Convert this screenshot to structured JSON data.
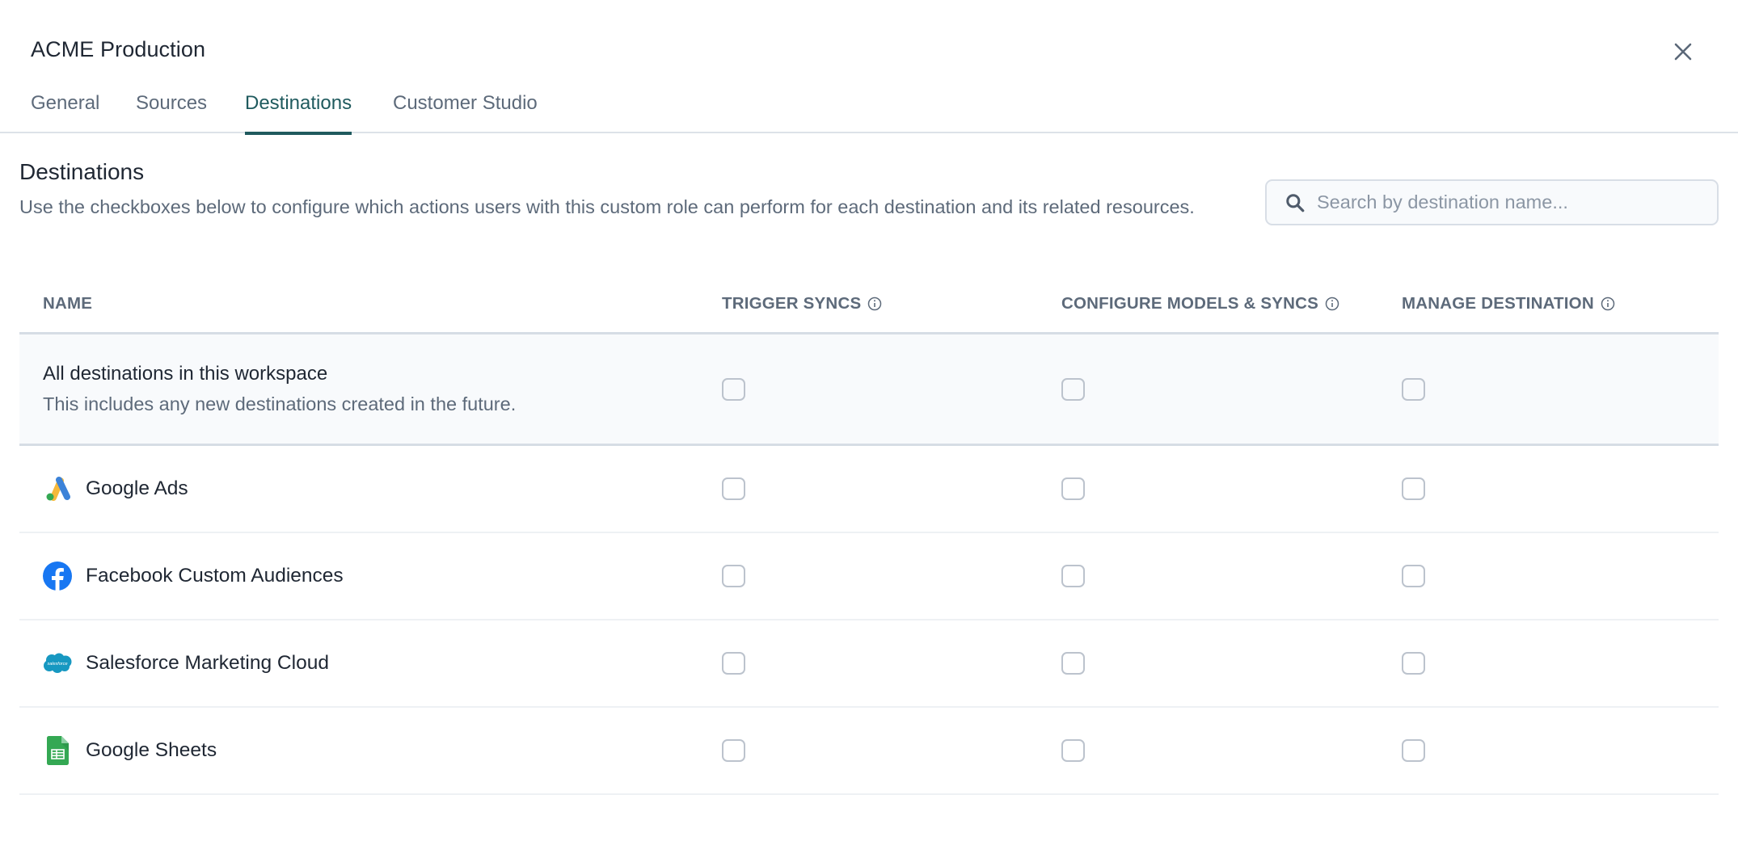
{
  "modal": {
    "title": "ACME Production",
    "close_icon": "close-icon"
  },
  "tabs": [
    {
      "label": "General",
      "active": false
    },
    {
      "label": "Sources",
      "active": false
    },
    {
      "label": "Destinations",
      "active": true
    },
    {
      "label": "Customer Studio",
      "active": false
    }
  ],
  "section": {
    "title": "Destinations",
    "description": "Use the checkboxes below to configure which actions users with this custom role can perform for each destination and its related resources."
  },
  "search": {
    "placeholder": "Search by destination name...",
    "value": "",
    "icon": "search-icon"
  },
  "table": {
    "columns": [
      {
        "label": "NAME",
        "info": false
      },
      {
        "label": "TRIGGER SYNCS",
        "info": true
      },
      {
        "label": "CONFIGURE MODELS & SYNCS",
        "info": true
      },
      {
        "label": "MANAGE DESTINATION",
        "info": true
      }
    ],
    "all_row": {
      "title": "All destinations in this workspace",
      "subtitle": "This includes any new destinations created in the future.",
      "trigger_syncs": false,
      "configure_models_syncs": false,
      "manage_destination": false
    },
    "rows": [
      {
        "name": "Google Ads",
        "icon": "google-ads-icon",
        "trigger_syncs": false,
        "configure_models_syncs": false,
        "manage_destination": false
      },
      {
        "name": "Facebook Custom Audiences",
        "icon": "facebook-icon",
        "trigger_syncs": false,
        "configure_models_syncs": false,
        "manage_destination": false
      },
      {
        "name": "Salesforce Marketing Cloud",
        "icon": "salesforce-icon",
        "trigger_syncs": false,
        "configure_models_syncs": false,
        "manage_destination": false
      },
      {
        "name": "Google Sheets",
        "icon": "google-sheets-icon",
        "trigger_syncs": false,
        "configure_models_syncs": false,
        "manage_destination": false
      }
    ]
  },
  "colors": {
    "accent": "#1f5a5e",
    "text_primary": "#1f2733",
    "text_secondary": "#5d6a7a",
    "facebook_blue": "#1877f2",
    "salesforce_blue": "#1798c1",
    "sheets_green": "#34a853"
  }
}
